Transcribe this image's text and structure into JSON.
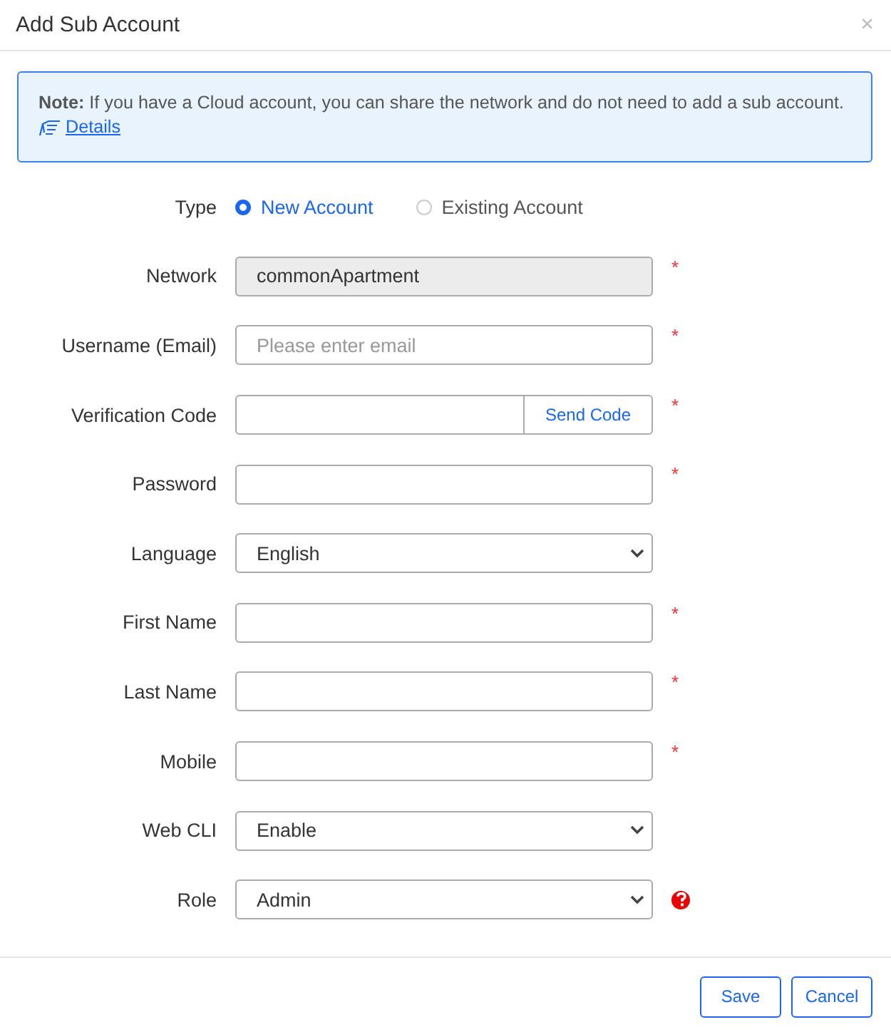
{
  "dialog": {
    "title": "Add Sub Account",
    "close": "×"
  },
  "note": {
    "text": "**Note:** If you have a Cloud account, you can share the network and do not need to add a sub account.",
    "link": "Details"
  },
  "fields": [
    {
      "kind": "radio",
      "label": "Type",
      "options": [
        {
          "label": "New Account",
          "selected": true
        },
        {
          "label": "Existing Account",
          "selected": false
        }
      ]
    },
    {
      "kind": "text",
      "label": "Network",
      "value": "commonApartment",
      "disabled": true,
      "required_mark": "*"
    },
    {
      "kind": "text",
      "label": "Username (Email)",
      "placeholder": "Please enter email",
      "disabled": false,
      "required_mark": "*"
    },
    {
      "kind": "code",
      "label": "Verification Code",
      "button": "Send Code",
      "required_mark": "*"
    },
    {
      "kind": "password",
      "label": "Password",
      "disabled": false,
      "required_mark": "*"
    },
    {
      "kind": "select",
      "label": "Language",
      "value": "English"
    },
    {
      "kind": "text",
      "label": "First Name",
      "disabled": false,
      "required_mark": "*"
    },
    {
      "kind": "text",
      "label": "Last Name",
      "disabled": false,
      "required_mark": "*"
    },
    {
      "kind": "text",
      "label": "Mobile",
      "disabled": false,
      "required_mark": "*"
    },
    {
      "kind": "select",
      "label": "Web CLI",
      "value": "Enable"
    },
    {
      "kind": "select",
      "label": "Role",
      "value": "Admin",
      "help": true
    }
  ],
  "buttons": [
    "Save",
    "Cancel"
  ]
}
